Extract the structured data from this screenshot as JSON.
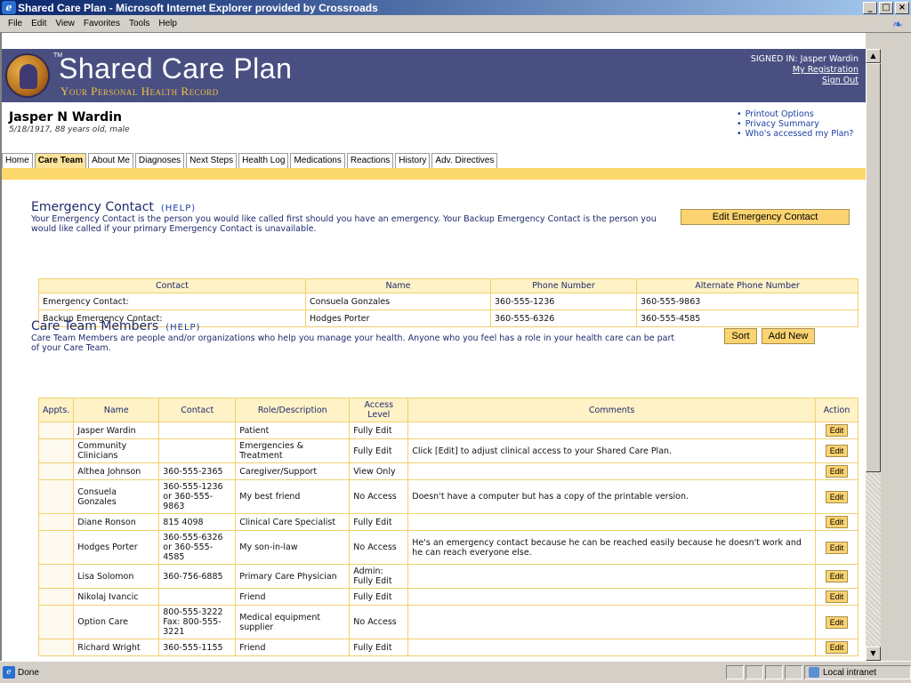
{
  "window": {
    "title": "Shared Care Plan - Microsoft Internet Explorer provided by Crossroads",
    "controls": [
      "_",
      "□",
      "×"
    ]
  },
  "menubar": [
    "File",
    "Edit",
    "View",
    "Favorites",
    "Tools",
    "Help"
  ],
  "brand": {
    "title": "Shared Care Plan",
    "tm": "TM",
    "subtitle": "Your Personal Health Record"
  },
  "signin": {
    "label": "SIGNED IN: Jasper Wardin",
    "my_registration": "My Registration",
    "sign_out": "Sign Out"
  },
  "patient": {
    "name": "Jasper N Wardin",
    "details": "5/18/1917, 88 years old, male"
  },
  "quicklinks": [
    "Printout Options",
    "Privacy Summary",
    "Who's accessed my Plan?"
  ],
  "tabs": [
    {
      "label": "Home",
      "active": false
    },
    {
      "label": "Care Team",
      "active": true
    },
    {
      "label": "About Me",
      "active": false
    },
    {
      "label": "Diagnoses",
      "active": false
    },
    {
      "label": "Next Steps",
      "active": false
    },
    {
      "label": "Health Log",
      "active": false
    },
    {
      "label": "Medications",
      "active": false
    },
    {
      "label": "Reactions",
      "active": false
    },
    {
      "label": "History",
      "active": false
    },
    {
      "label": "Adv. Directives",
      "active": false
    }
  ],
  "emergency": {
    "title": "Emergency Contact",
    "help": "(HELP)",
    "desc": "Your Emergency Contact is the person you would like called first should you have an emergency. Your Backup Emergency Contact is the person you would like called if your primary Emergency Contact is unavailable.",
    "edit_button": "Edit Emergency Contact",
    "headers": [
      "Contact",
      "Name",
      "Phone Number",
      "Alternate Phone Number"
    ],
    "rows": [
      [
        "Emergency Contact:",
        "Consuela Gonzales",
        "360-555-1236",
        "360-555-9863"
      ],
      [
        "Backup Emergency Contact:",
        "Hodges Porter",
        "360-555-6326",
        "360-555-4585"
      ]
    ]
  },
  "careteam": {
    "title": "Care Team Members",
    "help": "(HELP)",
    "desc": "Care Team Members are people and/or organizations who help you manage your health. Anyone who you feel has a role in your health care can be part of your Care Team.",
    "sort_button": "Sort",
    "add_button": "Add New",
    "headers": [
      "Appts.",
      "Name",
      "Contact",
      "Role/Description",
      "Access Level",
      "Comments",
      "Action"
    ],
    "edit_label": "Edit",
    "rows": [
      [
        "",
        "Jasper Wardin",
        "",
        "Patient",
        "Fully Edit",
        ""
      ],
      [
        "",
        "Community Clinicians",
        "",
        "Emergencies & Treatment",
        "Fully Edit",
        "Click [Edit] to adjust clinical access to your Shared Care Plan."
      ],
      [
        "",
        "Althea Johnson",
        "360-555-2365",
        "Caregiver/Support",
        "View Only",
        ""
      ],
      [
        "",
        "Consuela Gonzales",
        "360-555-1236 or 360-555-9863",
        "My best friend",
        "No Access",
        "Doesn't have a computer but has a copy of the printable version."
      ],
      [
        "",
        "Diane Ronson",
        "815 4098",
        "Clinical Care Specialist",
        "Fully Edit",
        ""
      ],
      [
        "",
        "Hodges Porter",
        "360-555-6326 or 360-555-4585",
        "My son-in-law",
        "No Access",
        "He's an emergency contact because he can be reached easily because he doesn't work and he can reach everyone else."
      ],
      [
        "",
        "Lisa Solomon",
        "360-756-6885",
        "Primary Care Physician",
        "Admin: Fully Edit",
        ""
      ],
      [
        "",
        "Nikolaj Ivancic",
        "",
        "Friend",
        "Fully Edit",
        ""
      ],
      [
        "",
        "Option Care",
        "800-555-3222 Fax: 800-555-3221",
        "Medical equipment supplier",
        "No Access",
        ""
      ],
      [
        "",
        "Richard Wright",
        "360-555-1155",
        "Friend",
        "Fully Edit",
        ""
      ]
    ]
  },
  "statusbar": {
    "status": "Done",
    "zone": "Local intranet"
  }
}
